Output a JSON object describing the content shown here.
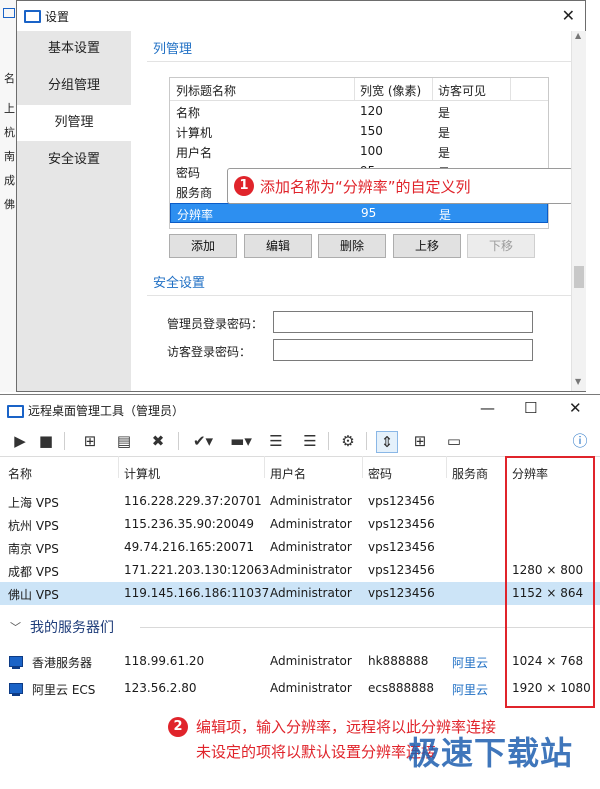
{
  "background_window": {
    "visible_texts": [
      "名",
      "上",
      "杭",
      "南",
      "成",
      "佛"
    ]
  },
  "settings_dialog": {
    "title": "设置",
    "close_glyph": "✕",
    "nav": [
      "基本设置",
      "分组管理",
      "列管理",
      "安全设置"
    ],
    "selected_nav": "列管理",
    "columns_section_title": "列管理",
    "grid_headers": [
      "列标题名称",
      "列宽 (像素)",
      "访客可见"
    ],
    "grid_rows": [
      {
        "name": "名称",
        "width": "120",
        "visible": "是"
      },
      {
        "name": "计算机",
        "width": "150",
        "visible": "是"
      },
      {
        "name": "用户名",
        "width": "100",
        "visible": "是"
      },
      {
        "name": "密码",
        "width": "95",
        "visible": "是"
      },
      {
        "name": "服务商",
        "width": "",
        "visible": ""
      },
      {
        "name": "分辨率",
        "width": "95",
        "visible": "是"
      }
    ],
    "buttons": [
      "添加",
      "编辑",
      "删除",
      "上移",
      "下移"
    ],
    "security_section_title": "安全设置",
    "admin_password_label": "管理员登录密码：",
    "guest_password_label": "访客登录密码：",
    "admin_password_value": "",
    "guest_password_value": ""
  },
  "callout1": {
    "number": "1",
    "text": "添加名称为“分辨率”的自定义列"
  },
  "main_window": {
    "title": "远程桌面管理工具（管理员）",
    "controls": [
      "—",
      "☐",
      "✕"
    ],
    "columns": [
      "名称",
      "计算机",
      "用户名",
      "密码",
      "服务商",
      "分辨率"
    ],
    "rows": [
      {
        "name": "上海 VPS",
        "computer": "116.228.229.37:20701",
        "user": "Administrator",
        "password": "vps123456",
        "provider": "",
        "resolution": ""
      },
      {
        "name": "杭州 VPS",
        "computer": "115.236.35.90:20049",
        "user": "Administrator",
        "password": "vps123456",
        "provider": "",
        "resolution": ""
      },
      {
        "name": "南京 VPS",
        "computer": "49.74.216.165:20071",
        "user": "Administrator",
        "password": "vps123456",
        "provider": "",
        "resolution": ""
      },
      {
        "name": "成都 VPS",
        "computer": "171.221.203.130:12063",
        "user": "Administrator",
        "password": "vps123456",
        "provider": "",
        "resolution": "1280 × 800"
      },
      {
        "name": "佛山 VPS",
        "computer": "119.145.166.186:11037",
        "user": "Administrator",
        "password": "vps123456",
        "provider": "",
        "resolution": "1152 × 864"
      }
    ],
    "group_title": "我的服务器们",
    "group_rows": [
      {
        "name": "香港服务器",
        "computer": "118.99.61.20",
        "user": "Administrator",
        "password": "hk888888",
        "provider": "阿里云",
        "resolution": "1024 × 768"
      },
      {
        "name": "阿里云 ECS",
        "computer": "123.56.2.80",
        "user": "Administrator",
        "password": "ecs888888",
        "provider": "阿里云",
        "resolution": "1920 × 1080"
      }
    ]
  },
  "callout2": {
    "number": "2",
    "line1": "编辑项，输入分辨率，远程将以此分辨率连接",
    "line2": "未设定的项将以默认设置分辨率连接"
  },
  "watermark": "极速下载站",
  "colors": {
    "accent_red": "#e0242b",
    "selection_blue": "#2d8ff0",
    "row_highlight": "#cce4f7",
    "link_blue": "#1f6fc4"
  }
}
